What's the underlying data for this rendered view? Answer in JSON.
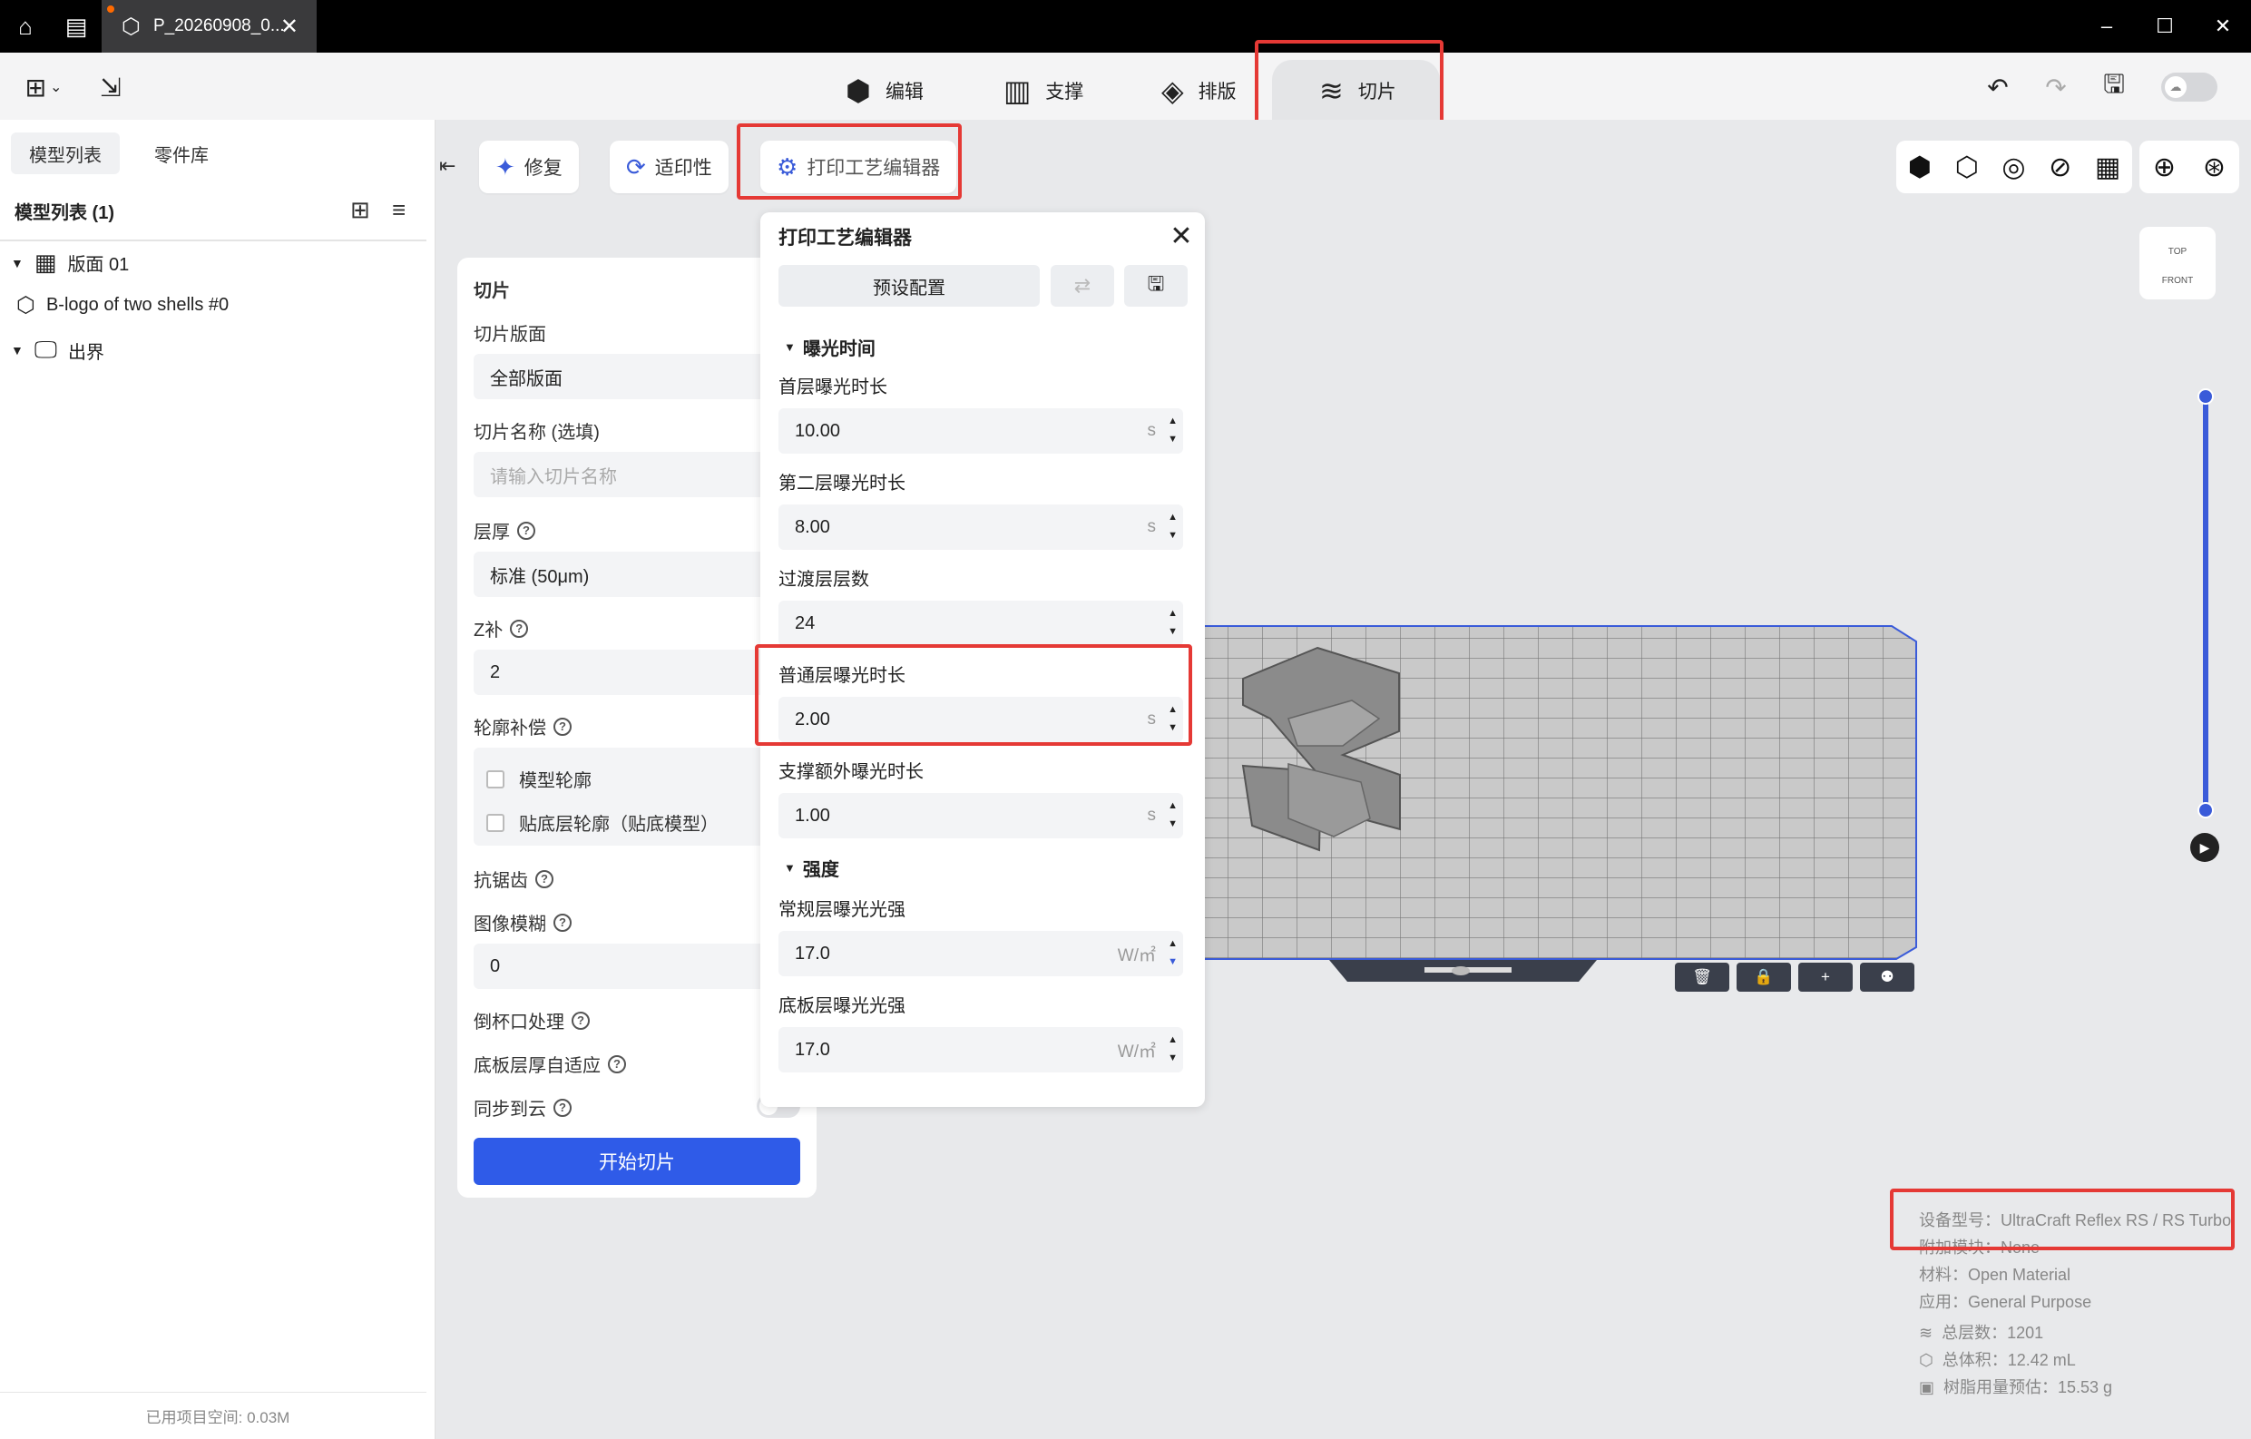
{
  "titlebar": {
    "doc_tab": "P_20260908_0...",
    "minimize": "–",
    "maximize": "☐",
    "close": "✕"
  },
  "modes": {
    "edit": "编辑",
    "support": "支撑",
    "layout": "排版",
    "slice": "切片"
  },
  "left_panel": {
    "tab_models": "模型列表",
    "tab_parts": "零件库",
    "list_title": "模型列表 (1)",
    "tree": {
      "plate": "版面 01",
      "model": "B-logo of two shells #0",
      "out_of_bounds": "出界"
    },
    "footer": "已用项目空间: 0.03M"
  },
  "subtoolbar": {
    "repair": "修复",
    "printability": "适印性",
    "process_editor": "打印工艺编辑器"
  },
  "slice_panel": {
    "title": "切片",
    "plate_label": "切片版面",
    "plate_value": "全部版面",
    "name_label": "切片名称 (选填)",
    "name_placeholder": "请输入切片名称",
    "layer_label": "层厚",
    "layer_value": "标准 (50μm)",
    "z_label": "Z补",
    "z_value": "2",
    "contour_label": "轮廓补偿",
    "contour_model": "模型轮廓",
    "contour_base": "贴底层轮廓（贴底模型）",
    "antialias_label": "抗锯齿",
    "blur_label": "图像模糊",
    "blur_value": "0",
    "cup_label": "倒杯口处理",
    "base_adapt_label": "底板层厚自适应",
    "cloud_label": "同步到云",
    "start_button": "开始切片"
  },
  "editor": {
    "title": "打印工艺编辑器",
    "preset": "预设配置",
    "section_exposure": "曝光时间",
    "first_layer_label": "首层曝光时长",
    "first_layer_value": "10.00",
    "second_layer_label": "第二层曝光时长",
    "second_layer_value": "8.00",
    "transition_label": "过渡层层数",
    "transition_value": "24",
    "normal_label": "普通层曝光时长",
    "normal_value": "2.00",
    "support_label": "支撑额外曝光时长",
    "support_value": "1.00",
    "section_intensity": "强度",
    "regular_intensity_label": "常规层曝光光强",
    "regular_intensity_value": "17.0",
    "base_intensity_label": "底板层曝光光强",
    "base_intensity_value": "17.0",
    "unit_s": "s",
    "unit_w": "W/㎡"
  },
  "viewport": {
    "navcube_top": "TOP",
    "navcube_front": "FRONT"
  },
  "info": {
    "device": "设备型号：UltraCraft Reflex RS / RS Turbo",
    "module": "附加模块：None",
    "material": "材料：Open Material",
    "application": "应用：General Purpose",
    "layers": "总层数：1201",
    "volume": "总体积：12.42 mL",
    "resin": "树脂用量预估：15.53 g"
  },
  "colors": {
    "accent": "#2f5be8",
    "highlight": "#e53935"
  }
}
